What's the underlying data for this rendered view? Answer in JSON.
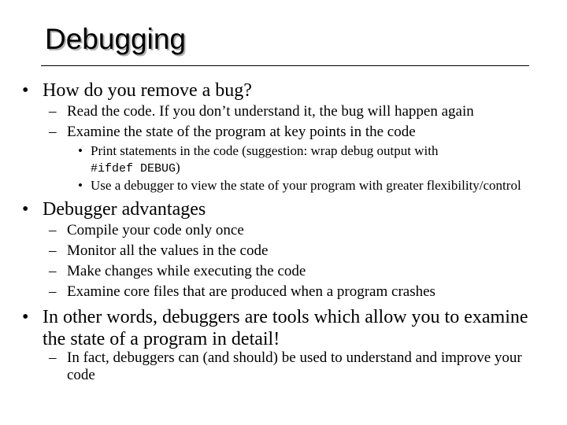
{
  "slide": {
    "title": "Debugging",
    "sections": [
      {
        "text": "How do you remove a bug?",
        "sub": [
          {
            "text": "Read the code.  If you don’t understand it, the bug will happen again"
          },
          {
            "text": "Examine the state of the program at key points in the code",
            "sub": [
              {
                "text_line1": "Print statements in the code (suggestion: wrap debug output with",
                "code": "#ifdef DEBUG",
                "text_after_code": ")"
              },
              {
                "text": "Use a debugger to view the state of your program with greater flexibility/control"
              }
            ]
          }
        ]
      },
      {
        "text": "Debugger advantages",
        "sub": [
          {
            "text": "Compile your code only once"
          },
          {
            "text": "Monitor all the values in the code"
          },
          {
            "text": "Make changes while executing the code"
          },
          {
            "text": "Examine core files that are produced when a program crashes"
          }
        ]
      },
      {
        "text_line1": "In other words, debuggers are tools which allow you to examine",
        "text_line2": "the state of a program in detail!",
        "sub": [
          {
            "text_line1": "In fact, debuggers can (and should) be used to understand and improve your",
            "text_line2": "code"
          }
        ]
      }
    ],
    "bullets": {
      "level1": "•",
      "level2": "–",
      "level3": "•"
    }
  }
}
